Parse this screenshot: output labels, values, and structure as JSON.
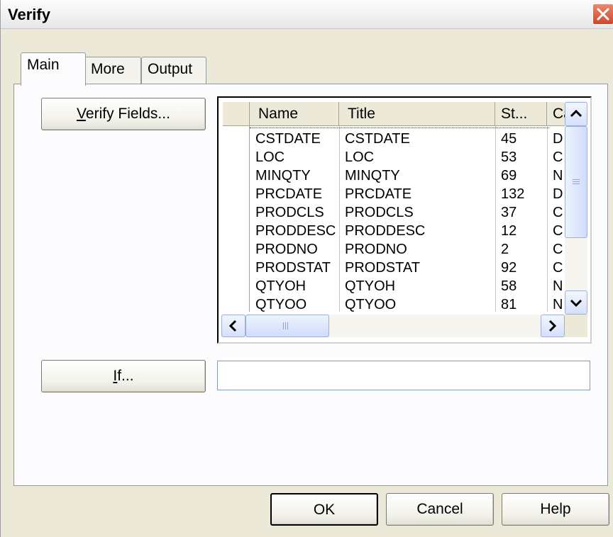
{
  "window": {
    "title": "Verify",
    "close_icon": "close-icon"
  },
  "tabs": [
    {
      "label": "Main",
      "active": true
    },
    {
      "label": "More",
      "active": false
    },
    {
      "label": "Output",
      "active": false
    }
  ],
  "main": {
    "verify_fields_label": "Verify Fields...",
    "if_label": "If...",
    "if_value": ""
  },
  "grid": {
    "columns": [
      "Name",
      "Title",
      "St...",
      "Ca"
    ],
    "rows": [
      {
        "name": "CSTDATE",
        "title": "CSTDATE",
        "st": "45",
        "ca": "D"
      },
      {
        "name": "LOC",
        "title": "LOC",
        "st": "53",
        "ca": "C"
      },
      {
        "name": "MINQTY",
        "title": "MINQTY",
        "st": "69",
        "ca": "N"
      },
      {
        "name": "PRCDATE",
        "title": "PRCDATE",
        "st": "132",
        "ca": "D"
      },
      {
        "name": "PRODCLS",
        "title": "PRODCLS",
        "st": "37",
        "ca": "C"
      },
      {
        "name": "PRODDESC",
        "title": "PRODDESC",
        "st": "12",
        "ca": "C"
      },
      {
        "name": "PRODNO",
        "title": "PRODNO",
        "st": "2",
        "ca": "C"
      },
      {
        "name": "PRODSTAT",
        "title": "PRODSTAT",
        "st": "92",
        "ca": "C"
      },
      {
        "name": "QTYOH",
        "title": "QTYOH",
        "st": "58",
        "ca": "N"
      },
      {
        "name": "QTYOO",
        "title": "QTYOO",
        "st": "81",
        "ca": "N"
      }
    ]
  },
  "footer": {
    "ok_label": "OK",
    "cancel_label": "Cancel",
    "help_label": "Help"
  }
}
